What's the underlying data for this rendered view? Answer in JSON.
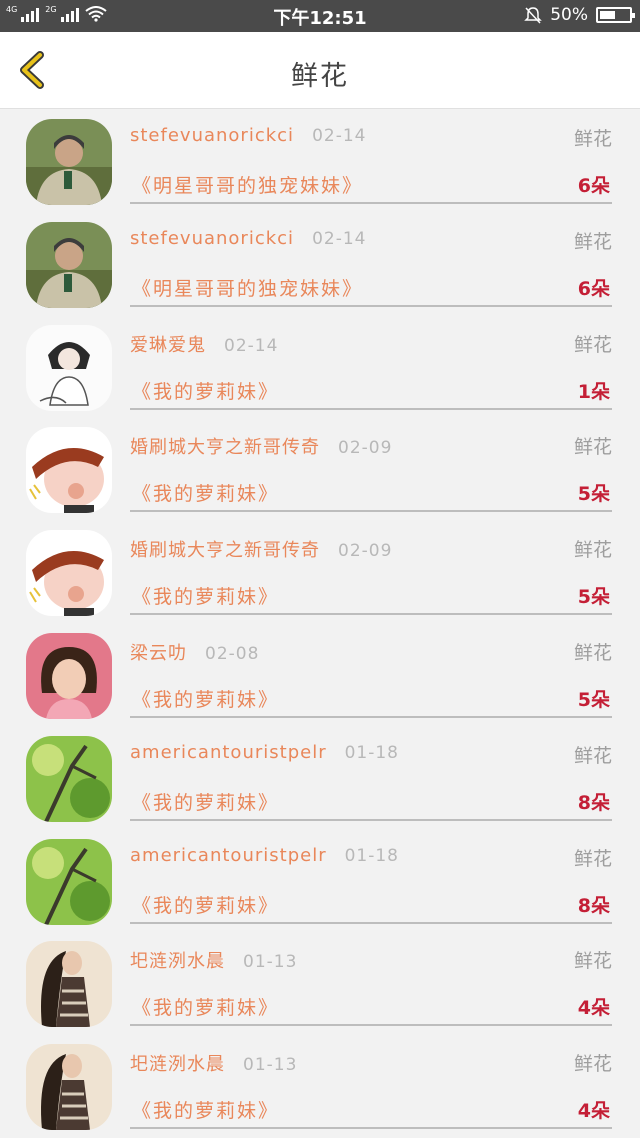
{
  "status": {
    "net1": "4G",
    "net2": "2G",
    "time": "下午12:51",
    "battery": "50%"
  },
  "nav": {
    "title": "鲜花",
    "back_icon": "chevron-left-icon",
    "accent_color": "#e8c21a"
  },
  "colors": {
    "name": "#e9875a",
    "count": "#c41f36",
    "gift": "#9e9e9e"
  },
  "rows": [
    {
      "name": "stefevuanorickci",
      "date": "02-14",
      "gift": "鲜花",
      "book": "《明星哥哥的独宠妹妹》",
      "count": "6朵"
    },
    {
      "name": "stefevuanorickci",
      "date": "02-14",
      "gift": "鲜花",
      "book": "《明星哥哥的独宠妹妹》",
      "count": "6朵"
    },
    {
      "name": "爱琳爱鬼",
      "date": "02-14",
      "gift": "鲜花",
      "book": "《我的萝莉妹》",
      "count": "1朵"
    },
    {
      "name": "婚刷城大亨之新哥传奇",
      "date": "02-09",
      "gift": "鲜花",
      "book": "《我的萝莉妹》",
      "count": "5朵"
    },
    {
      "name": "婚刷城大亨之新哥传奇",
      "date": "02-09",
      "gift": "鲜花",
      "book": "《我的萝莉妹》",
      "count": "5朵"
    },
    {
      "name": "梁云叻",
      "date": "02-08",
      "gift": "鲜花",
      "book": "《我的萝莉妹》",
      "count": "5朵"
    },
    {
      "name": "americantouristpelr",
      "date": "01-18",
      "gift": "鲜花",
      "book": "《我的萝莉妹》",
      "count": "8朵"
    },
    {
      "name": "americantouristpelr",
      "date": "01-18",
      "gift": "鲜花",
      "book": "《我的萝莉妹》",
      "count": "8朵"
    },
    {
      "name": "圯涟洌水晨",
      "date": "01-13",
      "gift": "鲜花",
      "book": "《我的萝莉妹》",
      "count": "4朵"
    },
    {
      "name": "圯涟洌水晨",
      "date": "01-13",
      "gift": "鲜花",
      "book": "《我的萝莉妹》",
      "count": "4朵"
    }
  ]
}
